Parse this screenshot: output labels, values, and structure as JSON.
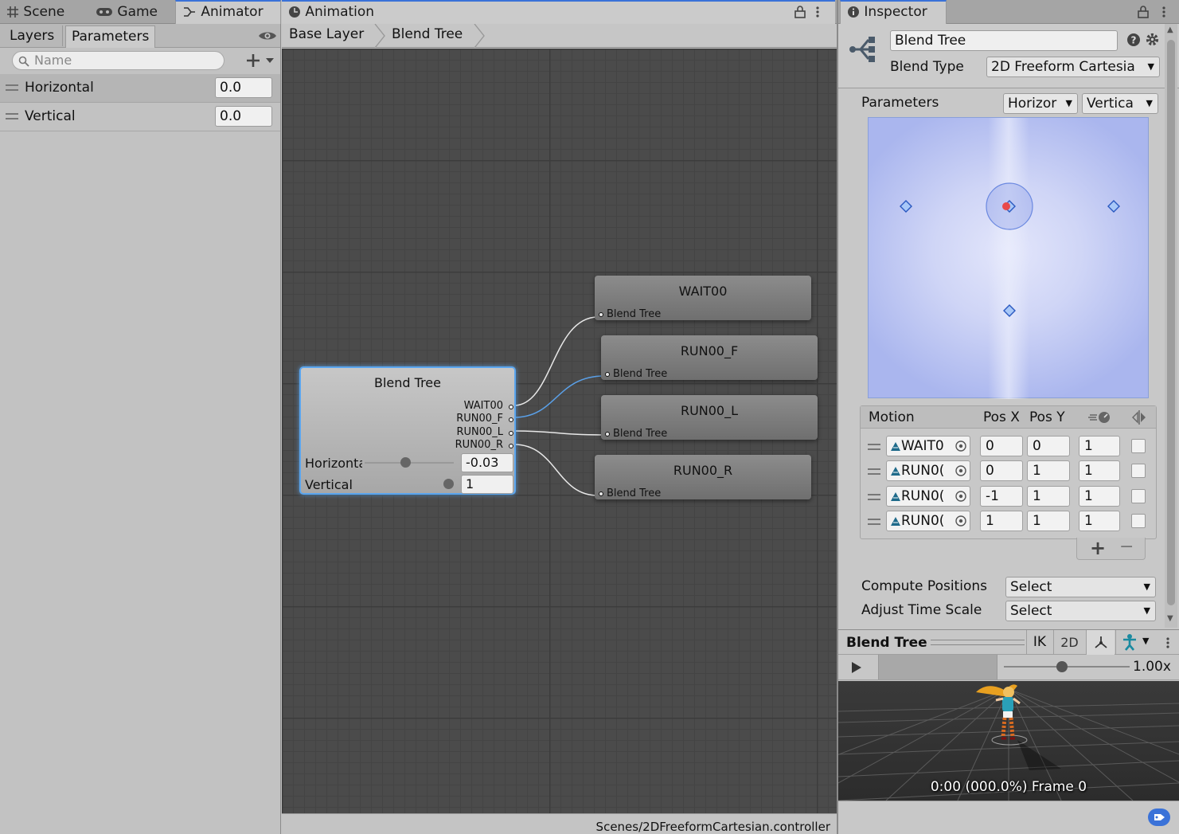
{
  "left_tabs": [
    {
      "label": "Scene",
      "icon": "grid-icon"
    },
    {
      "label": "Game",
      "icon": "gamepad-icon"
    },
    {
      "label": "Animator",
      "icon": "animator-icon"
    }
  ],
  "subtabs": {
    "layers": "Layers",
    "parameters": "Parameters"
  },
  "search": {
    "placeholder": "Name"
  },
  "params": [
    {
      "name": "Horizontal",
      "value": "0.0"
    },
    {
      "name": "Vertical",
      "value": "0.0"
    }
  ],
  "animation_tab": {
    "label": "Animation"
  },
  "breadcrumb": {
    "base": "Base Layer",
    "current": "Blend Tree"
  },
  "blend_node": {
    "title": "Blend Tree",
    "outputs": [
      "WAIT00",
      "RUN00_F",
      "RUN00_L",
      "RUN00_R"
    ],
    "horizontal_label": "Horizonta",
    "horizontal_value": "-0.03",
    "vertical_label": "Vertical",
    "vertical_value": "1"
  },
  "motion_nodes": [
    {
      "title": "WAIT00",
      "sub": "Blend Tree"
    },
    {
      "title": "RUN00_F",
      "sub": "Blend Tree"
    },
    {
      "title": "RUN00_L",
      "sub": "Blend Tree"
    },
    {
      "title": "RUN00_R",
      "sub": "Blend Tree"
    }
  ],
  "status_path": "Scenes/2DFreeformCartesian.controller",
  "inspector": {
    "tab": "Inspector",
    "name": "Blend Tree",
    "blend_type_label": "Blend Type",
    "blend_type_value": "2D Freeform Cartesia",
    "parameters_label": "Parameters",
    "param_x": "Horizor",
    "param_y": "Vertica",
    "motion_header": {
      "motion": "Motion",
      "posx": "Pos X",
      "posy": "Pos Y"
    },
    "motions": [
      {
        "clip": "WAIT0",
        "x": "0",
        "y": "0",
        "speed": "1"
      },
      {
        "clip": "RUN0(",
        "x": "0",
        "y": "1",
        "speed": "1"
      },
      {
        "clip": "RUN0(",
        "x": "-1",
        "y": "1",
        "speed": "1"
      },
      {
        "clip": "RUN0(",
        "x": "1",
        "y": "1",
        "speed": "1"
      }
    ],
    "add": "+",
    "remove": "−",
    "compute_label": "Compute Positions",
    "compute_value": "Select",
    "adjust_label": "Adjust Time Scale",
    "adjust_value": "Select"
  },
  "preview": {
    "title": "Blend Tree",
    "ik": "IK",
    "mode2d": "2D",
    "speed": "1.00x",
    "speed_fraction": 0.46,
    "frame": "0:00 (000.0%) Frame 0"
  },
  "colors": {
    "accent": "#3a72d8",
    "graph_bg": "#4b4b4b",
    "panel": "#c2c2c2"
  }
}
